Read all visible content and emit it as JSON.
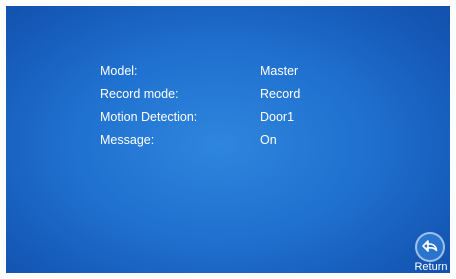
{
  "settings": [
    {
      "label": "Model:",
      "value": "Master"
    },
    {
      "label": "Record mode:",
      "value": "Record"
    },
    {
      "label": "Motion Detection:",
      "value": "Door1"
    },
    {
      "label": "Message:",
      "value": "On"
    }
  ],
  "return_button": {
    "label": "Return",
    "icon": "return-icon"
  },
  "colors": {
    "background": "#1f70cf",
    "text": "#ffffff"
  }
}
